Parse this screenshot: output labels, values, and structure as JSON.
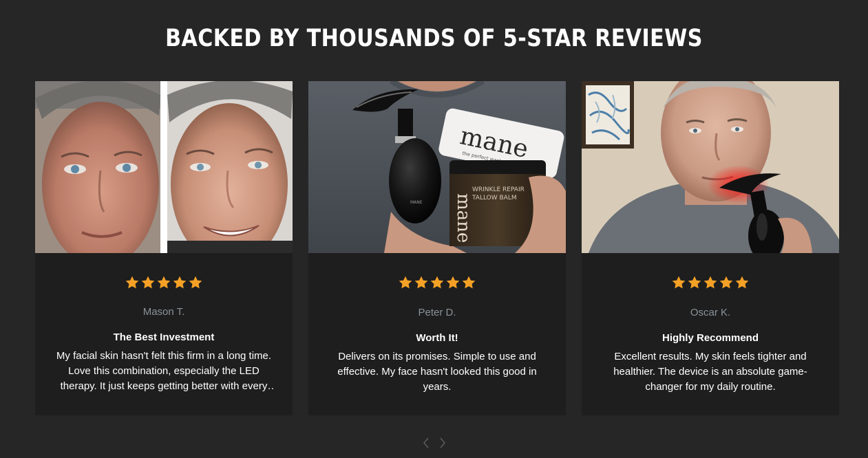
{
  "section": {
    "title": "BACKED BY THOUSANDS OF 5-STAR REVIEWS"
  },
  "colors": {
    "background": "#262626",
    "card": "#1e1e1e",
    "star": "#f5a126",
    "reviewer": "#8b9298",
    "text": "#ffffff",
    "pager": "#5a5a5a"
  },
  "reviews": [
    {
      "rating": 5,
      "reviewer": "Mason T.",
      "title": "The Best Investment",
      "text": "My facial skin hasn't felt this firm in a long time. Love this combination, especially the LED therapy. It just keeps getting better with every use.",
      "image": "before-after-face-photo"
    },
    {
      "rating": 5,
      "reviewer": "Peter D.",
      "title": "Worth It!",
      "text": "Delivers on its promises. Simple to use and effective. My face hasn't looked this good in years.",
      "image": "device-and-products-photo",
      "product_labels": {
        "brand": "mane",
        "bottle_sub": "the perfect wash",
        "jar_title_1": "WRINKLE REPAIR",
        "jar_title_2": "TALLOW BALM",
        "device_brand": "MANE"
      }
    },
    {
      "rating": 5,
      "reviewer": "Oscar K.",
      "title": "Highly Recommend",
      "text": "Excellent results. My skin feels tighter and healthier. The device is an absolute game-changer for my daily routine.",
      "image": "man-using-red-light-device-photo"
    }
  ],
  "pager": {
    "prev_icon": "chevron-left-icon",
    "next_icon": "chevron-right-icon"
  }
}
